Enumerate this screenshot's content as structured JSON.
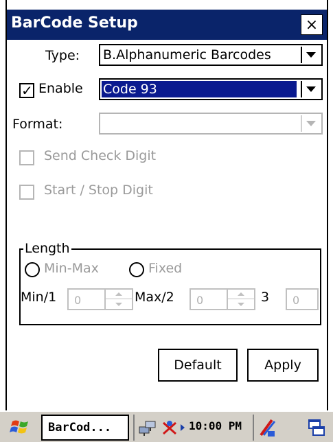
{
  "window": {
    "title": "BarCode Setup",
    "close_label": "×"
  },
  "type": {
    "label": "Type:",
    "value": "B.Alphanumeric Barcodes"
  },
  "enable": {
    "label": "Enable",
    "checked": true,
    "check_glyph": "✓",
    "value": "Code 93"
  },
  "format": {
    "label": "Format:",
    "value": ""
  },
  "options": {
    "send_check_digit": "Send Check Digit",
    "start_stop_digit": "Start / Stop Digit"
  },
  "length": {
    "legend": "Length",
    "min_max": "Min-Max",
    "fixed": "Fixed",
    "min_label": "Min/1",
    "min_value": "0",
    "max_label": "Max/2",
    "max_value": "0",
    "third_label": "3",
    "third_value": "0"
  },
  "buttons": {
    "default": "Default",
    "apply": "Apply"
  },
  "taskbar": {
    "task_label": "BarCod...",
    "clock": "10:00 PM"
  },
  "colors": {
    "titlebar": "#0a246a",
    "selection": "#0a1a8f",
    "disabled_text": "#9a9a9a"
  }
}
